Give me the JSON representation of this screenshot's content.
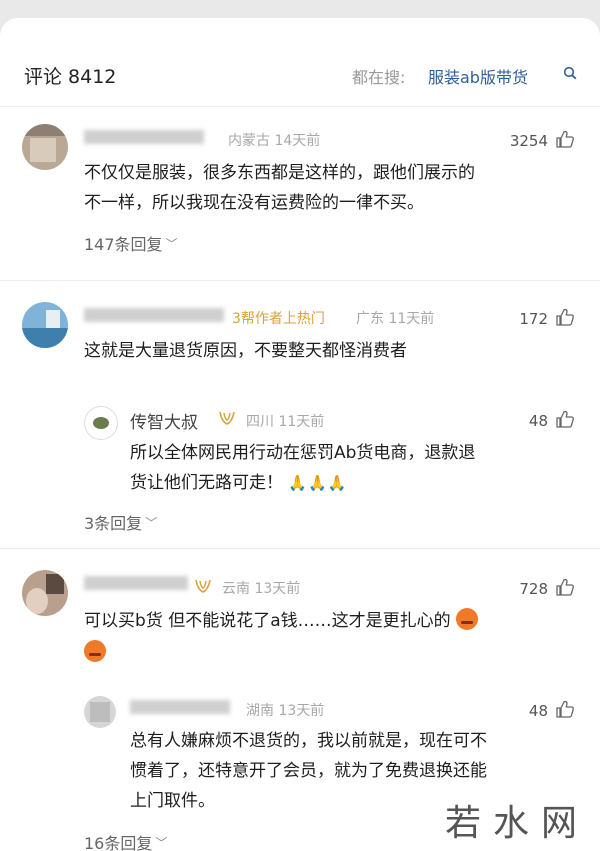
{
  "header": {
    "title": "评论 8412",
    "search_label": "都在搜:",
    "search_keyword": "服装ab版带货"
  },
  "comments": [
    {
      "location_time": "内蒙古 14天前",
      "likes": "3254",
      "line1": "不仅仅是服装，很多东西都是这样的，跟他们展示的",
      "line2": "不一样，所以我现在没有运费险的一律不买。",
      "replies_label": "147条回复"
    },
    {
      "tag": "3帮作者上热门",
      "location_time": "广东 11天前",
      "likes": "172",
      "line1": "这就是大量退货原因，不要整天都怪消费者",
      "reply": {
        "name": "传智大叔",
        "location_time": "四川 11天前",
        "likes": "48",
        "line1": "所以全体网民用行动在惩罚Ab货电商，退款退",
        "line2": "货让他们无路可走！"
      },
      "replies_label": "3条回复"
    },
    {
      "location_time": "云南 13天前",
      "likes": "728",
      "line1": "可以买b货 但不能说花了a钱……这才是更扎心的",
      "reply": {
        "location_time": "湖南 13天前",
        "likes": "48",
        "line1": "总有人嫌麻烦不退货的，我以前就是，现在可不",
        "line2": "惯着了，还特意开了会员，就为了免费退换还能",
        "line3": "上门取件。"
      },
      "replies_label": "16条回复"
    }
  ],
  "watermark": "若水网",
  "colors": {
    "link": "#2f5e9a",
    "gold": "#d9a23a",
    "meta": "#a8a8a8"
  },
  "icons": [
    "search-icon",
    "like-icon",
    "chevron-down-icon",
    "badge-icon",
    "emoji-icon",
    "pray-emoji"
  ]
}
